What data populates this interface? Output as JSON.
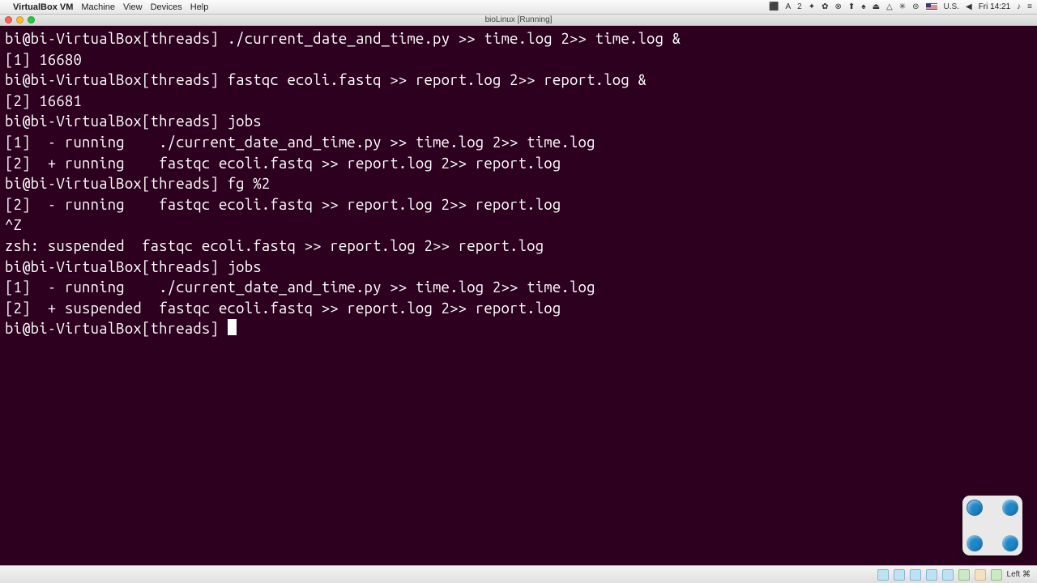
{
  "menubar": {
    "apple": "",
    "app": "VirtualBox VM",
    "items": [
      "Machine",
      "View",
      "Devices",
      "Help"
    ],
    "right": {
      "icons": [
        "⚡",
        "A",
        "2",
        "✦",
        "✿",
        "⊗",
        "⬆",
        "♠",
        "⏏",
        "△",
        "✳",
        "⊜",
        "U.S.",
        "◀"
      ],
      "clock": "Fri 14:21",
      "extra": "♪  ≡"
    }
  },
  "vm": {
    "title": "bioLinux [Running]"
  },
  "prompt": {
    "user": "bi@bi-VirtualBox",
    "dir": "[threads]"
  },
  "term": {
    "l01_cmd": "./current_date_and_time.py >> time.log 2>> time.log &",
    "l02": "[1] 16680",
    "l03_cmd": "fastqc ecoli.fastq >> report.log 2>> report.log &",
    "l04": "[2] 16681",
    "l05_cmd": "jobs",
    "l06": "[1]  - running    ./current_date_and_time.py >> time.log 2>> time.log",
    "l07": "[2]  + running    fastqc ecoli.fastq >> report.log 2>> report.log",
    "l08_cmd": "fg %2",
    "l09": "[2]  - running    fastqc ecoli.fastq >> report.log 2>> report.log",
    "l10": "^Z",
    "l11": "zsh: suspended  fastqc ecoli.fastq >> report.log 2>> report.log",
    "l12_cmd": "jobs",
    "l13": "[1]  - running    ./current_date_and_time.py >> time.log 2>> time.log",
    "l14": "[2]  + suspended  fastqc ecoli.fastq >> report.log 2>> report.log"
  },
  "status": {
    "hostkey": "Left ⌘"
  }
}
